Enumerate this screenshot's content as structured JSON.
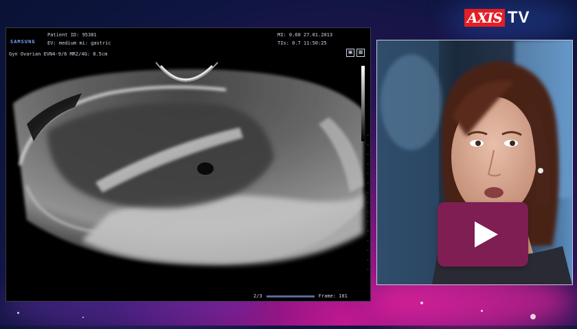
{
  "logo": {
    "part1": "AXIS",
    "part2": "TV"
  },
  "ultrasound": {
    "brand": "SAMSUNG",
    "patient_id": "Patient ID: 95381",
    "probe_line": "EV: medium   mi: gastric",
    "datetime_line": "MI: 0.60   27.01.2013",
    "time_line": "TIs: 0.7   11:50:25",
    "preset_line": "Gyn Ovarian   EVN4-9/6  MR2/4G: 8.5cm",
    "footer_left": "2/3",
    "footer_right": "Frame: 101"
  },
  "video": {
    "play_label": "Play video"
  },
  "colors": {
    "accent_logo_red": "#e41e26",
    "play_button": "#7e1e52",
    "background_magenta": "#c2188f",
    "background_navy": "#0e1540"
  },
  "icons": [
    "play-icon"
  ]
}
